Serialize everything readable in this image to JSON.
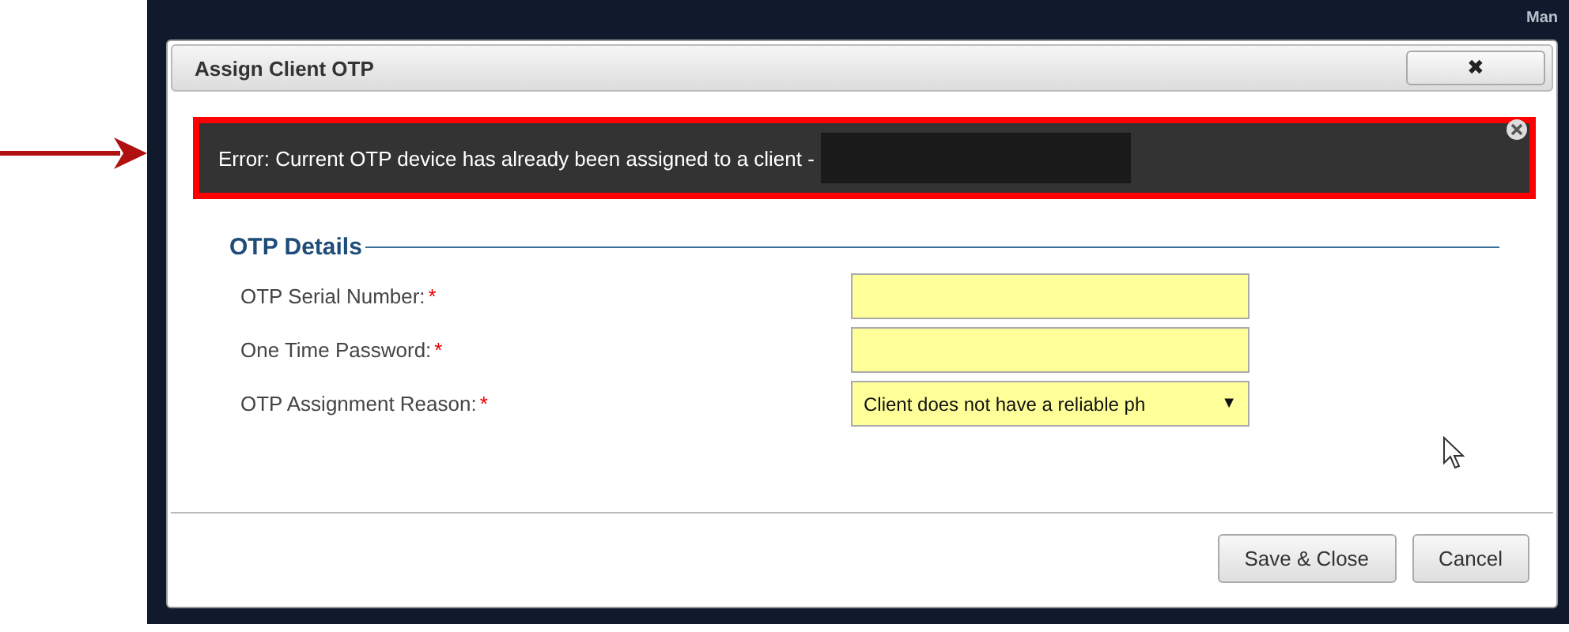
{
  "background": {
    "header_text": "Man"
  },
  "dialog": {
    "title": "Assign Client OTP",
    "close_label": "✖",
    "error": {
      "message": "Error: Current OTP device has already been assigned to a client -",
      "redacted": true
    },
    "section_title": "OTP Details",
    "fields": [
      {
        "label": "OTP Serial Number:",
        "required": true,
        "required_mark": "*",
        "kind": "text"
      },
      {
        "label": "One Time Password:",
        "required": true,
        "required_mark": "*",
        "kind": "text"
      },
      {
        "label": "OTP Assignment Reason:",
        "required": true,
        "required_mark": "*",
        "kind": "select",
        "value": "Client does not have a reliable ph",
        "caret": "▼"
      }
    ],
    "buttons": [
      {
        "label": "Save & Close"
      },
      {
        "label": "Cancel"
      }
    ]
  }
}
